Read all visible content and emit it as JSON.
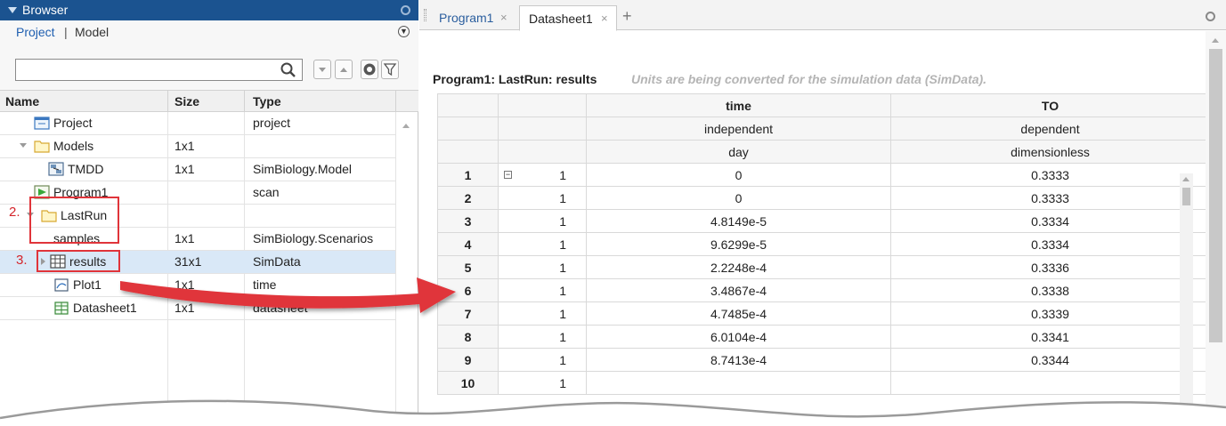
{
  "browser": {
    "title": "Browser",
    "links": {
      "project": "Project",
      "separator": "|",
      "model": "Model"
    },
    "search": {
      "value": "",
      "placeholder": ""
    },
    "columns": {
      "name": "Name",
      "size": "Size",
      "type": "Type"
    },
    "rows": [
      {
        "name": "Project",
        "size": "",
        "type": "project",
        "icon": "project-icon"
      },
      {
        "name": "Models",
        "size": "1x1",
        "type": "",
        "icon": "folder-icon",
        "expanded": true
      },
      {
        "name": "TMDD",
        "size": "1x1",
        "type": "SimBiology.Model",
        "icon": "model-icon"
      },
      {
        "name": "Program1",
        "size": "",
        "type": "scan",
        "icon": "program-icon"
      },
      {
        "name": "LastRun",
        "size": "",
        "type": "",
        "icon": "folder-icon",
        "expanded": true
      },
      {
        "name": "samples",
        "size": "1x1",
        "type": "SimBiology.Scenarios",
        "icon": ""
      },
      {
        "name": "results",
        "size": "31x1",
        "type": "SimData",
        "icon": "table-icon",
        "selected": true
      },
      {
        "name": "Plot1",
        "size": "1x1",
        "type": "time",
        "icon": "plot-icon"
      },
      {
        "name": "Datasheet1",
        "size": "1x1",
        "type": "datasheet",
        "icon": "datasheet-icon"
      }
    ]
  },
  "annotations": {
    "step2": "2.",
    "step3": "3.",
    "highlight_color": "#e0343a"
  },
  "tabs": [
    {
      "label": "Program1",
      "close": "×",
      "active": false
    },
    {
      "label": "Datasheet1",
      "close": "×",
      "active": true
    }
  ],
  "tab_add": "+",
  "datasheet": {
    "title": "Program1: LastRun: results",
    "note": "Units are being converted for the simulation data (SimData).",
    "columns": [
      {
        "name": "time",
        "role": "independent",
        "unit": "day"
      },
      {
        "name": "TO",
        "role": "dependent",
        "unit": "dimensionless"
      }
    ],
    "group_toggle": "⊟",
    "rows": [
      {
        "row": "1",
        "group": "1",
        "time": "0",
        "TO": "0.3333"
      },
      {
        "row": "2",
        "group": "1",
        "time": "0",
        "TO": "0.3333"
      },
      {
        "row": "3",
        "group": "1",
        "time": "4.8149e-5",
        "TO": "0.3334"
      },
      {
        "row": "4",
        "group": "1",
        "time": "9.6299e-5",
        "TO": "0.3334"
      },
      {
        "row": "5",
        "group": "1",
        "time": "2.2248e-4",
        "TO": "0.3336"
      },
      {
        "row": "6",
        "group": "1",
        "time": "3.4867e-4",
        "TO": "0.3338"
      },
      {
        "row": "7",
        "group": "1",
        "time": "4.7485e-4",
        "TO": "0.3339"
      },
      {
        "row": "8",
        "group": "1",
        "time": "6.0104e-4",
        "TO": "0.3341"
      },
      {
        "row": "9",
        "group": "1",
        "time": "8.7413e-4",
        "TO": "0.3344"
      },
      {
        "row": "10",
        "group": "1",
        "time": "",
        "TO": ""
      }
    ]
  },
  "colors": {
    "titlebar": "#1b5390",
    "link": "#1f5fb0",
    "selection": "#d9e8f7",
    "arrow": "#e0343a"
  }
}
